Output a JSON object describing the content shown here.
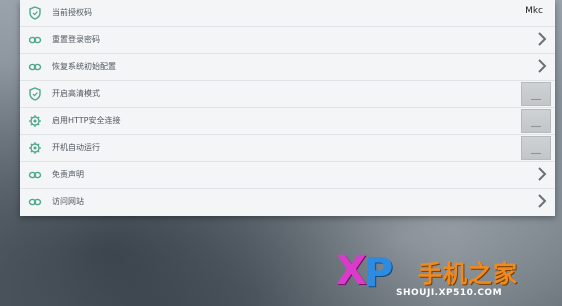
{
  "settings": {
    "rows": [
      {
        "label": "当前授权码",
        "value": "Mkc",
        "icon": "shield-icon"
      },
      {
        "label": "重置登录密码",
        "icon": "link-icon"
      },
      {
        "label": "恢复系统初始配置",
        "icon": "link-icon"
      },
      {
        "label": "开启高清模式",
        "icon": "shield-icon"
      },
      {
        "label": "启用HTTP安全连接",
        "icon": "gear-icon"
      },
      {
        "label": "开机自动运行",
        "icon": "gear-icon"
      },
      {
        "label": "免责声明",
        "icon": "link-icon"
      },
      {
        "label": "访问网站",
        "icon": "link-icon"
      }
    ]
  },
  "watermark": {
    "logo_x": "X",
    "logo_p": "P",
    "name": "手机之家",
    "url": "SHOUJI.XP510.COM"
  },
  "colors": {
    "icon_green": "#4fa88a",
    "panel_bg": "#f4f5f6"
  }
}
